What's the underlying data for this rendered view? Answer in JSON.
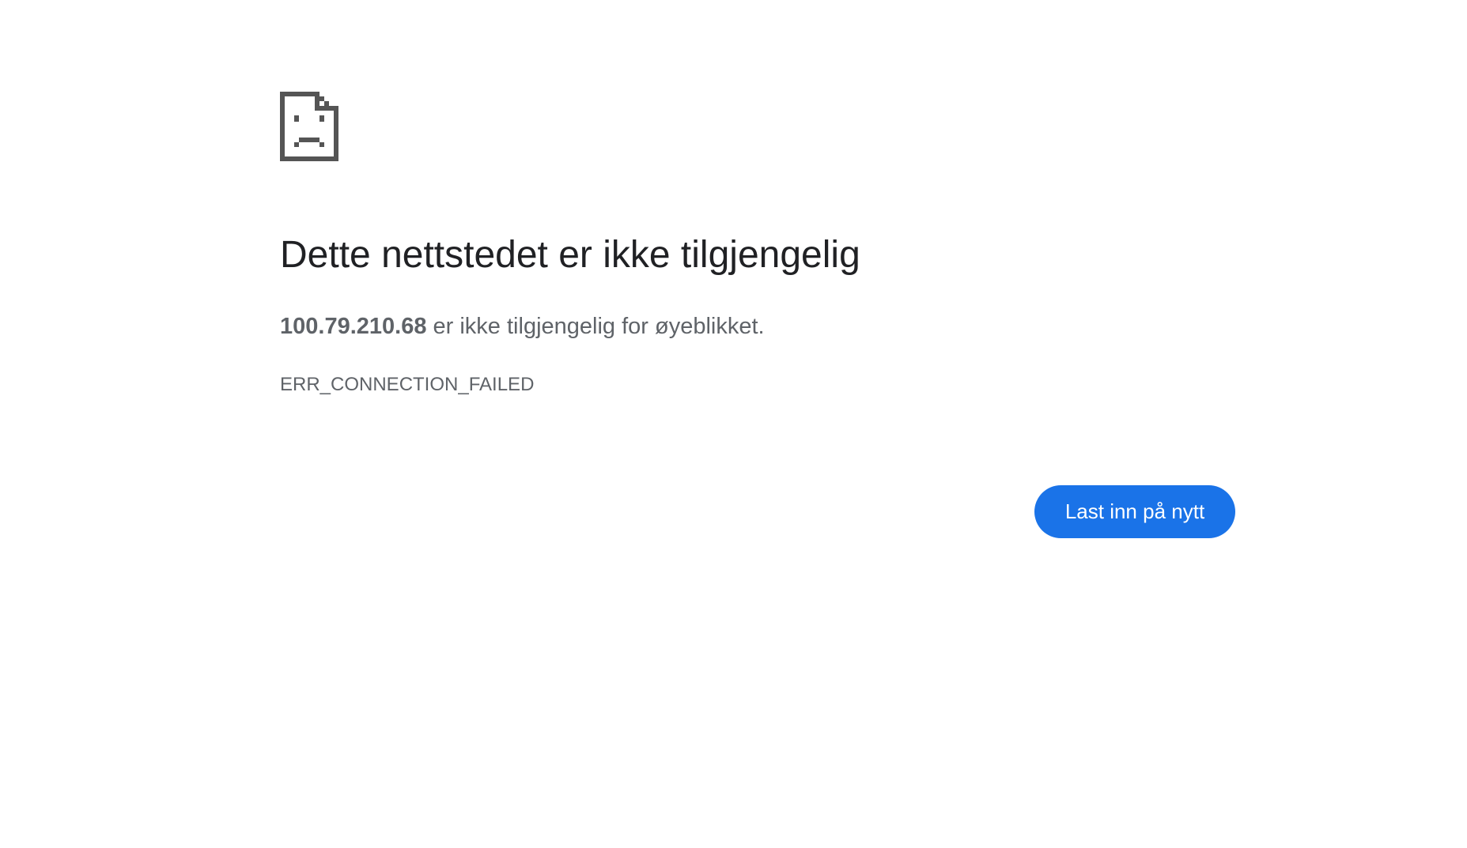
{
  "icon": {
    "name": "sad-file-icon",
    "color": "#555555"
  },
  "title": "Dette nettstedet er ikke tilgjengelig",
  "message": {
    "host": "100.79.210.68",
    "text": " er ikke tilgjengelig for øyeblikket."
  },
  "error_code": "ERR_CONNECTION_FAILED",
  "reload_button": {
    "label": "Last inn på nytt",
    "color": "#1a73e8"
  }
}
